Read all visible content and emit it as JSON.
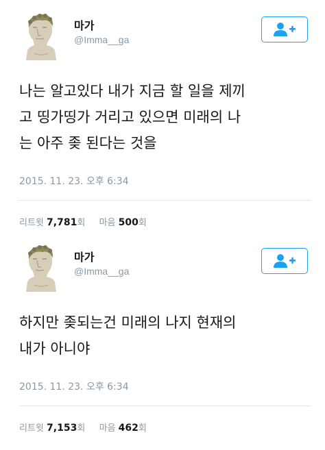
{
  "colors": {
    "accent": "#1da1f2",
    "muted": "#8899a6",
    "text": "#14171a",
    "divider": "#e1e8ed"
  },
  "tweets": [
    {
      "avatar_icon": "caesar-bust-avatar",
      "display_name": "마가",
      "handle": "@Imma__ga",
      "follow_icon": "add-user-icon",
      "text": "나는 알고있다 내가 지금 할 일을 제끼\n고 띵가띵가 거리고 있으면 미래의 나\n는 아주 좆 된다는 것을",
      "timestamp": "2015. 11. 23. 오후 6:34",
      "retweet_label": "리트윗",
      "retweet_count": "7,781",
      "retweet_unit": "회",
      "like_label": "마음",
      "like_count": "500",
      "like_unit": "회"
    },
    {
      "avatar_icon": "caesar-bust-avatar",
      "display_name": "마가",
      "handle": "@Imma__ga",
      "follow_icon": "add-user-icon",
      "text": "하지만 좆되는건 미래의 나지 현재의\n내가 아니야",
      "timestamp": "2015. 11. 23. 오후 6:34",
      "retweet_label": "리트윗",
      "retweet_count": "7,153",
      "retweet_unit": "회",
      "like_label": "마음",
      "like_count": "462",
      "like_unit": "회"
    }
  ]
}
